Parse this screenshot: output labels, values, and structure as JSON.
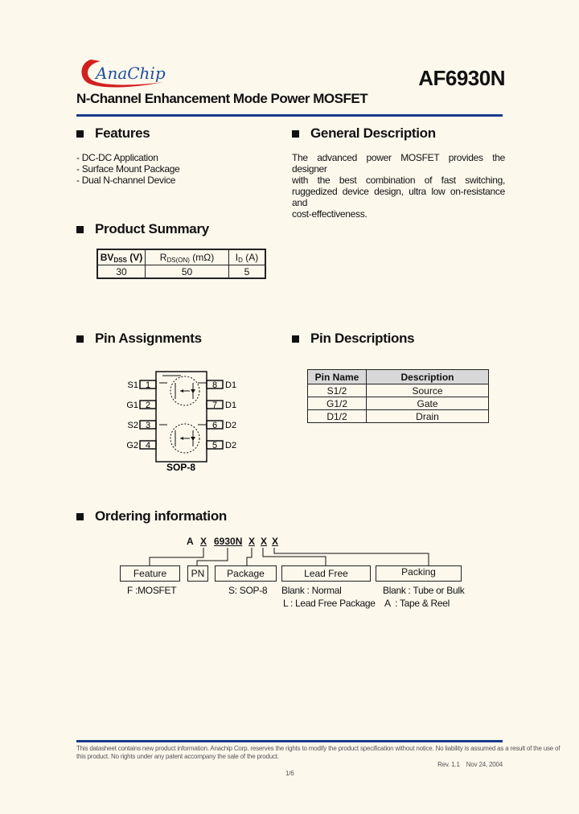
{
  "header": {
    "logo_text": "AnaChip",
    "part_number": "AF6930N",
    "subtitle": "N-Channel Enhancement Mode Power MOSFET"
  },
  "features": {
    "title": "Features",
    "items": [
      "- DC-DC Application",
      "- Surface Mount Package",
      "- Dual N-channel Device"
    ]
  },
  "general_description": {
    "title": "General Description",
    "lines": [
      "The advanced power MOSFET provides the designer",
      "with the best combination of fast switching,",
      "ruggedized device design, ultra low on-resistance and",
      "cost-effectiveness."
    ]
  },
  "product_summary": {
    "title": "Product Summary",
    "headers": [
      {
        "main": "BV",
        "sub": "DSS",
        "unit": " (V)"
      },
      {
        "main": "R",
        "sub": "DS(ON)",
        "unit": " (mΩ)"
      },
      {
        "main": "I",
        "sub": "D",
        "unit": " (A)"
      }
    ],
    "values": [
      "30",
      "50",
      "5"
    ]
  },
  "pin_assignments": {
    "title": "Pin Assignments",
    "package_label": "SOP-8",
    "left_pins": [
      {
        "num": "1",
        "name": "S1"
      },
      {
        "num": "2",
        "name": "G1"
      },
      {
        "num": "3",
        "name": "S2"
      },
      {
        "num": "4",
        "name": "G2"
      }
    ],
    "right_pins": [
      {
        "num": "8",
        "name": "D1"
      },
      {
        "num": "7",
        "name": "D1"
      },
      {
        "num": "6",
        "name": "D2"
      },
      {
        "num": "5",
        "name": "D2"
      }
    ]
  },
  "pin_descriptions": {
    "title": "Pin Descriptions",
    "headers": [
      "Pin Name",
      "Description"
    ],
    "rows": [
      [
        "S1/2",
        "Source"
      ],
      [
        "G1/2",
        "Gate"
      ],
      [
        "D1/2",
        "Drain"
      ]
    ]
  },
  "ordering": {
    "title": "Ordering information",
    "code": [
      "A",
      "X",
      "6930N",
      "X",
      "X",
      "X"
    ],
    "boxes": [
      "Feature",
      "PN",
      "Package",
      "Lead Free",
      "Packing"
    ],
    "notes": {
      "feature": "F :MOSFET",
      "package": "S: SOP-8",
      "lead_free": [
        "Blank : Normal",
        "L : Lead Free Package"
      ],
      "packing": [
        "Blank : Tube or Bulk",
        "A  : Tape & Reel"
      ]
    }
  },
  "footer": {
    "disclaimer_1": "This datasheet contains new product information. Anachip Corp. reserves the rights to modify the product specification without notice. No liability is assumed as a result of the use of",
    "disclaimer_2": "this product. No rights under any patent accompany the sale of the product.",
    "revision": "Rev. 1.1    Nov 24, 2004",
    "page": "1/6"
  }
}
